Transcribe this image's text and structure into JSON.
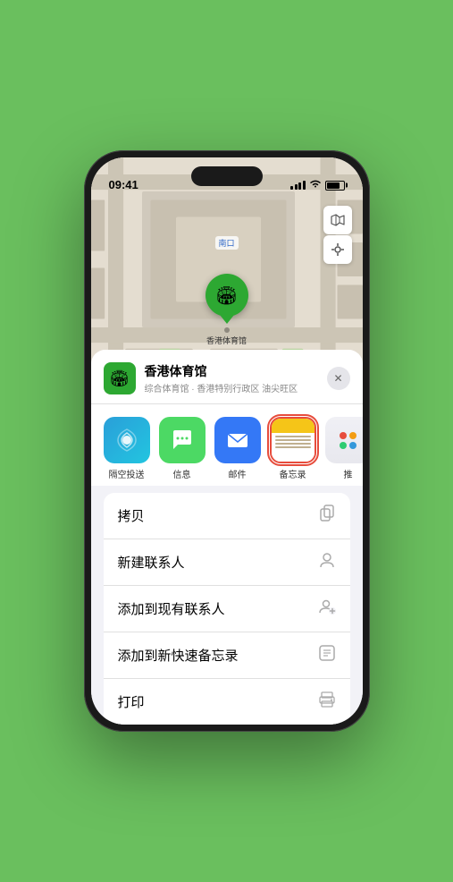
{
  "status": {
    "time": "09:41",
    "location_arrow": "▶"
  },
  "map": {
    "label": "南口",
    "pin_label": "香港体育馆"
  },
  "venue": {
    "name": "香港体育馆",
    "subtitle": "综合体育馆 · 香港特别行政区 油尖旺区",
    "icon": "🏟"
  },
  "share_items": [
    {
      "id": "airdrop",
      "label": "隔空投送",
      "type": "airdrop"
    },
    {
      "id": "messages",
      "label": "信息",
      "type": "messages"
    },
    {
      "id": "mail",
      "label": "邮件",
      "type": "mail"
    },
    {
      "id": "notes",
      "label": "备忘录",
      "type": "notes",
      "selected": true
    },
    {
      "id": "more",
      "label": "推",
      "type": "more"
    }
  ],
  "actions": [
    {
      "id": "copy",
      "label": "拷贝",
      "icon": "⎘"
    },
    {
      "id": "new-contact",
      "label": "新建联系人",
      "icon": "👤"
    },
    {
      "id": "add-existing",
      "label": "添加到现有联系人",
      "icon": "👤+"
    },
    {
      "id": "quick-note",
      "label": "添加到新快速备忘录",
      "icon": "📋"
    },
    {
      "id": "print",
      "label": "打印",
      "icon": "🖨"
    }
  ],
  "close_btn": "✕"
}
